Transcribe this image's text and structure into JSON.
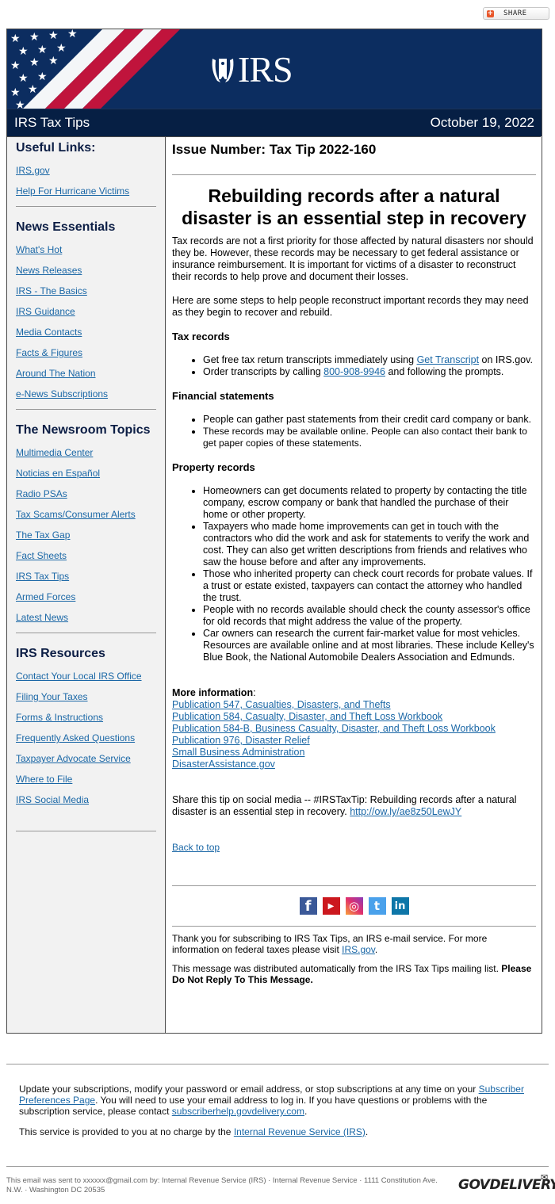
{
  "share": {
    "label": "SHARE",
    "icon": "plus-icon"
  },
  "header": {
    "logo_text": "IRS",
    "newsletter_title": "IRS Tax Tips",
    "date": "October 19, 2022"
  },
  "sidebar": {
    "sections": [
      {
        "title": "Useful Links:",
        "links": [
          "IRS.gov",
          "Help For Hurricane Victims"
        ]
      },
      {
        "title": "News Essentials",
        "links": [
          "What's Hot",
          "News Releases",
          "IRS - The Basics",
          "IRS Guidance",
          "Media Contacts",
          "Facts & Figures",
          "Around The Nation",
          "e-News Subscriptions"
        ]
      },
      {
        "title": "The Newsroom Topics",
        "links": [
          "Multimedia Center",
          "Noticias en Español",
          "Radio PSAs",
          "Tax Scams/Consumer Alerts",
          "The Tax Gap",
          "Fact Sheets",
          "IRS Tax Tips",
          "Armed Forces",
          "Latest News"
        ]
      },
      {
        "title": "IRS Resources",
        "links": [
          "Contact Your Local IRS Office",
          "Filing Your Taxes",
          "Forms & Instructions",
          "Frequently Asked Questions",
          "Taxpayer Advocate Service",
          "Where to File",
          "IRS Social Media"
        ]
      }
    ]
  },
  "article": {
    "issue": "Issue Number: Tax Tip 2022-160",
    "headline": "Rebuilding records after a natural disaster is an essential step in recovery",
    "intro": [
      "Tax records are not a first priority for those affected by natural disasters nor should they be. However, these records may be necessary to get federal assistance or insurance reimbursement. It is important for victims of a disaster to reconstruct their records to help prove and document their losses.",
      "Here are some steps to help people reconstruct important records they may need as they begin to recover and rebuild."
    ],
    "tax_records": {
      "title": "Tax records",
      "item1_before": "Get free tax return transcripts immediately using ",
      "item1_link": "Get Transcript",
      "item1_after": " on IRS.gov.",
      "item2_before": "Order transcripts by calling ",
      "item2_link": "800-908-9946",
      "item2_after": " and following the prompts."
    },
    "financial": {
      "title": "Financial statements",
      "items": [
        "People can gather past statements from their credit card company or bank.",
        "These records may be available online. People can also contact their bank to get paper copies of these statements."
      ]
    },
    "property": {
      "title": "Property records",
      "items": [
        "Homeowners can get documents related to property by contacting the title company, escrow company or bank that handled the purchase of their home or other property.",
        "Taxpayers who made home improvements can get in touch with the contractors who did the work and ask for statements to verify the work and cost. They can also get written descriptions from friends and relatives who saw the house before and after any improvements.",
        "Those who inherited property can check court records for probate values. If a trust or estate existed, taxpayers can contact the attorney who handled the trust.",
        "People with no records available should check the county assessor's office for old records that might address the value of the property.",
        "Car owners can research the current fair-market value for most vehicles. Resources are available online and at most libraries. These include Kelley's Blue Book, the National Automobile Dealers Association and Edmunds."
      ]
    },
    "more_info": {
      "title": "More information",
      "colon": ":",
      "links": [
        "Publication 547, Casualties, Disasters, and Thefts",
        "Publication 584, Casualty, Disaster, and Theft Loss Workbook",
        "Publication 584-B, Business Casualty, Disaster, and Theft Loss Workbook",
        "Publication 976, Disaster Relief",
        "Small Business Administration",
        "DisasterAssistance.gov"
      ]
    },
    "share_tip_text": "Share this tip on social media -- #IRSTaxTip: Rebuilding records after a natural disaster is an essential step in recovery. ",
    "share_tip_link": "http://ow.ly/ae8z50LewJY",
    "back_to_top": "Back to top",
    "social": [
      {
        "name": "facebook",
        "glyph": "f",
        "color": "#3b5998"
      },
      {
        "name": "youtube",
        "glyph": "▶",
        "color": "#cc181e"
      },
      {
        "name": "instagram",
        "glyph": "◎",
        "color": "#e1306c"
      },
      {
        "name": "twitter",
        "glyph": "t",
        "color": "#4aa1eb"
      },
      {
        "name": "linkedin",
        "glyph": "in",
        "color": "#0e76a8"
      }
    ],
    "thanks_before": "Thank you for subscribing to IRS Tax Tips, an IRS e-mail service. For more information on federal taxes please visit ",
    "thanks_link": "IRS.gov",
    "thanks_after": ".",
    "auto_msg": "This message was distributed automatically from the IRS Tax Tips mailing list. ",
    "auto_msg_bold": "Please Do Not Reply To This Message."
  },
  "footer": {
    "subs_before": "Update your subscriptions, modify your password or email address, or stop subscriptions at any time on your ",
    "subs_link1": "Subscriber Preferences Page",
    "subs_middle": ". You will need to use your email address to log in. If you have questions or problems with the subscription service, please contact ",
    "subs_link2": "subscriberhelp.govdelivery.com",
    "subs_after": ".",
    "provided_before": "This service is provided to you at no charge by the ",
    "provided_link": "Internal Revenue Service (IRS)",
    "provided_after": ".",
    "sent_to": "This email was sent to xxxxxx@gmail.com by: Internal Revenue Service (IRS) · Internal Revenue Service · 1111 Constitution Ave. N.W. · Washington DC 20535",
    "brand": "GOVDELIVERY"
  }
}
